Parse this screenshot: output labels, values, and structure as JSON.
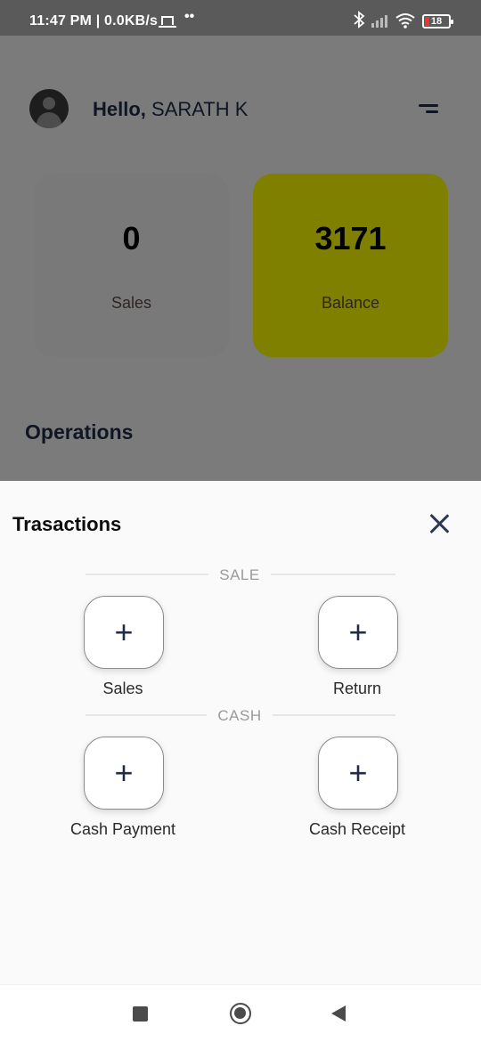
{
  "status_bar": {
    "time_speed": "11:47 PM | 0.0KB/s",
    "dots": "••",
    "battery_level": "18",
    "icons": [
      "laptop-icon",
      "bluetooth-icon",
      "signal-icon",
      "wifi-icon",
      "battery-icon"
    ]
  },
  "header": {
    "hello": "Hello,",
    "user_name": "SARATH K"
  },
  "summary_cards": {
    "sales": {
      "value": "0",
      "label": "Sales"
    },
    "balance": {
      "value": "3171",
      "label": "Balance",
      "color": "#ffff00"
    }
  },
  "operations_title": "Operations",
  "sheet": {
    "title": "Trasactions",
    "sections": {
      "sale": {
        "label": "SALE",
        "items": [
          {
            "label": "Sales",
            "icon": "plus-icon"
          },
          {
            "label": "Return",
            "icon": "plus-icon"
          }
        ]
      },
      "cash": {
        "label": "CASH",
        "items": [
          {
            "label": "Cash Payment",
            "icon": "plus-icon"
          },
          {
            "label": "Cash Receipt",
            "icon": "plus-icon"
          }
        ]
      }
    },
    "plus_glyph": "+"
  },
  "colors": {
    "primary_text": "#1f2c46",
    "balance_card": "#ffff00",
    "sales_card": "#f3f3f3",
    "status_bar": "#5a5a5a"
  },
  "nav_bar": {
    "icons": [
      "recents-icon",
      "home-icon",
      "back-icon"
    ]
  }
}
